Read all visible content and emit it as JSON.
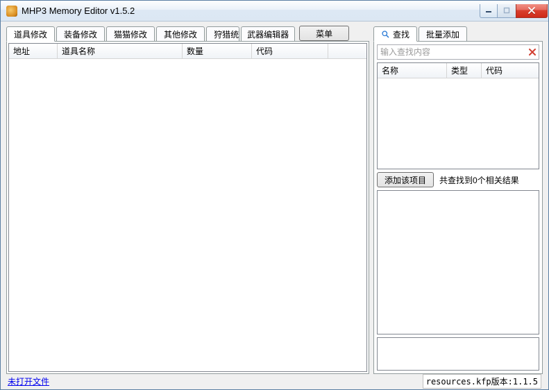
{
  "window": {
    "title": "MHP3 Memory Editor v1.5.2"
  },
  "left": {
    "tabs": [
      {
        "label": "道具修改"
      },
      {
        "label": "装备修改"
      },
      {
        "label": "猫猫修改"
      },
      {
        "label": "其他修改"
      },
      {
        "label": "狩猎统计"
      }
    ],
    "weapon_tab": "武器编辑器",
    "menu_button": "菜单",
    "columns": {
      "addr": "地址",
      "name": "道具名称",
      "qty": "数量",
      "code": "代码"
    }
  },
  "right": {
    "tabs": {
      "search": "查找",
      "batch": "批量添加"
    },
    "search_placeholder": "输入查找内容",
    "columns": {
      "name": "名称",
      "type": "类型",
      "code": "代码"
    },
    "add_button": "添加该项目",
    "result_text": "共查找到0个相关结果"
  },
  "status": {
    "left_link": "未打开文件",
    "right_text": "resources.kfp版本:1.1.5"
  }
}
